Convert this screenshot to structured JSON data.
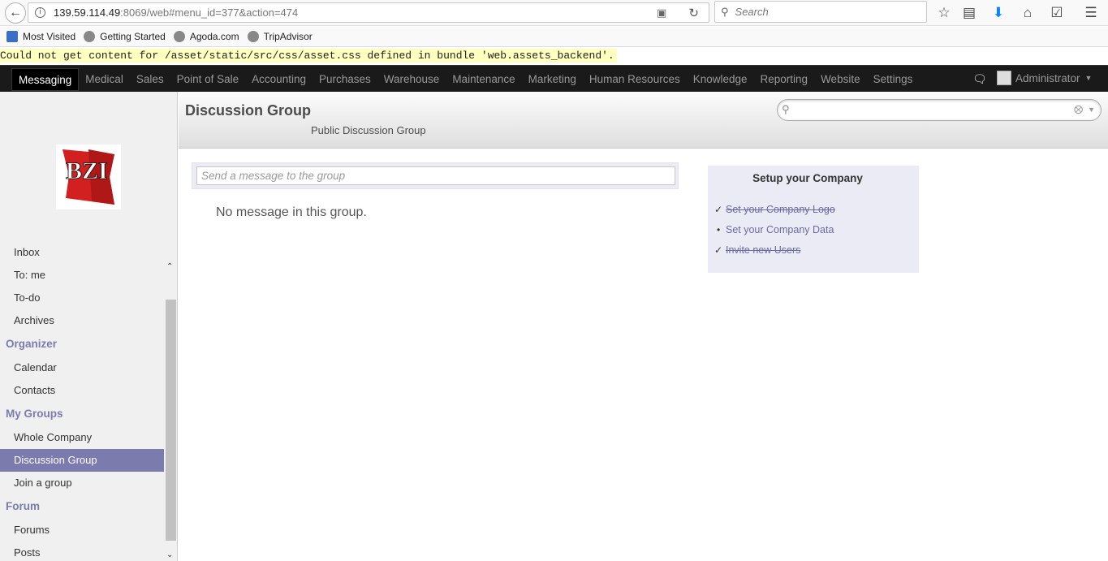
{
  "browser": {
    "url_host": "139.59.114.49",
    "url_rest": ":8069/web#menu_id=377&action=474",
    "search_placeholder": "Search"
  },
  "bookmarks": [
    {
      "label": "Most Visited",
      "icon": "bookmark-folder-icon"
    },
    {
      "label": "Getting Started",
      "icon": "globe-icon"
    },
    {
      "label": "Agoda.com",
      "icon": "globe-icon"
    },
    {
      "label": "TripAdvisor",
      "icon": "globe-icon"
    }
  ],
  "error_message": "Could not get content for /asset/static/src/css/asset.css defined in bundle 'web.assets_backend'.",
  "topmenu": {
    "items": [
      "Messaging",
      "Medical",
      "Sales",
      "Point of Sale",
      "Accounting",
      "Purchases",
      "Warehouse",
      "Maintenance",
      "Marketing",
      "Human Resources",
      "Knowledge",
      "Reporting",
      "Website",
      "Settings"
    ],
    "active": "Messaging",
    "user": "Administrator"
  },
  "sidebar": {
    "logo_text": "BZI",
    "items": [
      {
        "type": "item",
        "label": "Inbox"
      },
      {
        "type": "item",
        "label": "To: me"
      },
      {
        "type": "item",
        "label": "To-do"
      },
      {
        "type": "item",
        "label": "Archives"
      },
      {
        "type": "section",
        "label": "Organizer"
      },
      {
        "type": "item",
        "label": "Calendar"
      },
      {
        "type": "item",
        "label": "Contacts"
      },
      {
        "type": "section",
        "label": "My Groups"
      },
      {
        "type": "item",
        "label": "Whole Company"
      },
      {
        "type": "item",
        "label": "Discussion Group",
        "active": true
      },
      {
        "type": "item",
        "label": "Join a group"
      },
      {
        "type": "section",
        "label": "Forum"
      },
      {
        "type": "item",
        "label": "Forums"
      },
      {
        "type": "item",
        "label": "Posts"
      }
    ]
  },
  "header": {
    "title": "Discussion Group",
    "subtitle": "Public Discussion Group"
  },
  "composer": {
    "placeholder": "Send a message to the group"
  },
  "empty_text": "No message in this group.",
  "setup": {
    "title": "Setup your Company",
    "items": [
      {
        "label": "Set your Company Logo",
        "done": true
      },
      {
        "label": "Set your Company Data",
        "done": false
      },
      {
        "label": "Invite new Users",
        "done": true
      }
    ]
  },
  "colors": {
    "accent": "#7c7bad",
    "menu_bg": "#1a1a1a",
    "error_bg": "#ffffc0"
  }
}
